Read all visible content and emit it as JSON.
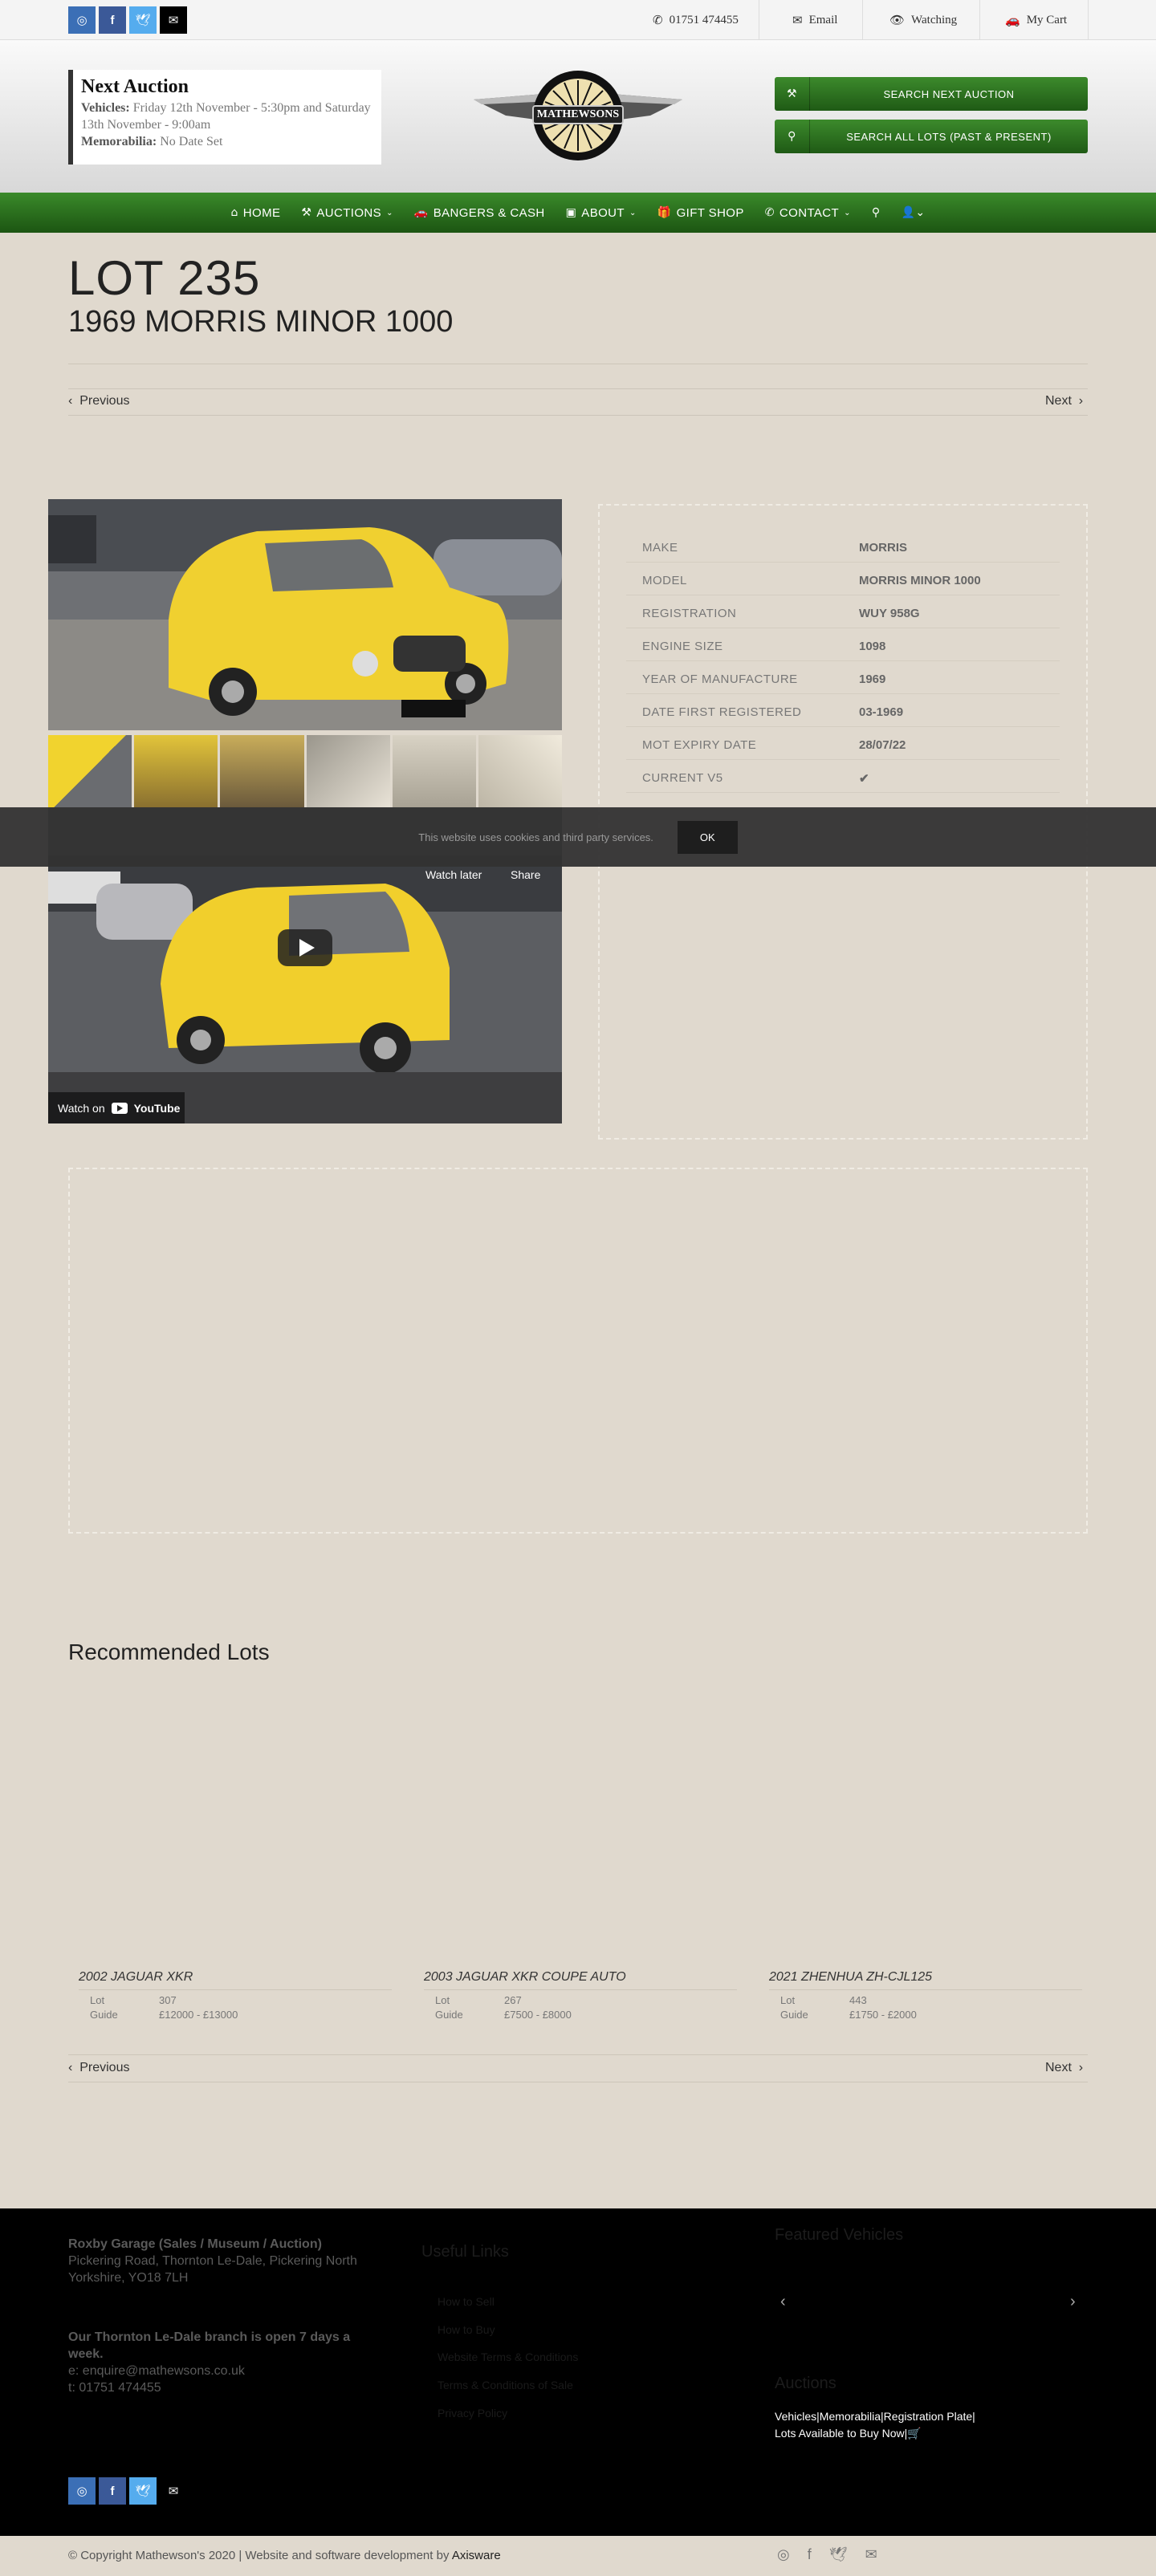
{
  "topbar": {
    "phone": "01751 474455",
    "email": "Email",
    "watching": "Watching",
    "cart": "My Cart"
  },
  "auction_box": {
    "title": "Next Auction",
    "vehicles_label": "Vehicles:",
    "vehicles_text": "Friday 12th November - 5:30pm and Saturday 13th November - 9:00am",
    "memorabilia_label": "Memorabilia:",
    "memorabilia_text": "No Date Set"
  },
  "logo": {
    "text": "MATHEWSONS"
  },
  "buttons": {
    "search_next": "SEARCH NEXT AUCTION",
    "search_all": "SEARCH ALL LOTS (PAST & PRESENT)"
  },
  "nav": {
    "home": "HOME",
    "auctions": "AUCTIONS",
    "bangers": "BANGERS & CASH",
    "about": "ABOUT",
    "gift": "GIFT SHOP",
    "contact": "CONTACT"
  },
  "lot": {
    "number": "LOT 235",
    "title": "1969 MORRIS MINOR 1000"
  },
  "pager": {
    "previous": "Previous",
    "next": "Next"
  },
  "video": {
    "watch_later": "Watch later",
    "share": "Share",
    "watch_on": "Watch on",
    "youtube": "YouTube"
  },
  "specs": [
    {
      "k": "MAKE",
      "v": "MORRIS"
    },
    {
      "k": "MODEL",
      "v": "MORRIS MINOR 1000"
    },
    {
      "k": "REGISTRATION",
      "v": "WUY 958G"
    },
    {
      "k": "ENGINE SIZE",
      "v": "1098"
    },
    {
      "k": "YEAR OF MANUFACTURE",
      "v": "1969"
    },
    {
      "k": "DATE FIRST REGISTERED",
      "v": "03-1969"
    },
    {
      "k": "MOT EXPIRY DATE",
      "v": "28/07/22"
    },
    {
      "k": "CURRENT V5",
      "v": "✔"
    }
  ],
  "cookie": {
    "text": "This website uses cookies and third party services.",
    "ok": "OK"
  },
  "recommended": {
    "heading": "Recommended Lots",
    "items": [
      {
        "title": "2002 JAGUAR XKR",
        "lot_label": "Lot",
        "lot": "307",
        "guide_label": "Guide",
        "guide": "£12000 - £13000"
      },
      {
        "title": "2003 JAGUAR XKR COUPE AUTO",
        "lot_label": "Lot",
        "lot": "267",
        "guide_label": "Guide",
        "guide": "£7500 - £8000"
      },
      {
        "title": "2021 ZHENHUA ZH-CJL125",
        "lot_label": "Lot",
        "lot": "443",
        "guide_label": "Guide",
        "guide": "£1750 - £2000"
      }
    ]
  },
  "footer": {
    "address_title": "Roxby Garage (Sales / Museum / Auction)",
    "address": "Pickering Road, Thornton Le-Dale, Pickering North Yorkshire, YO18 7LH",
    "open": "Our Thornton Le-Dale branch is open 7 days a week.",
    "email": "e: enquire@mathewsons.co.uk",
    "phone": "t: 01751 474455",
    "useful_links": "Useful Links",
    "links": [
      "How to Sell",
      "How to Buy",
      "Website Terms & Conditions",
      "Terms & Conditions of Sale",
      "Privacy Policy"
    ],
    "featured": "Featured Vehicles",
    "auctions": "Auctions",
    "auction_links_1": "Vehicles|Memorabilia|Registration Plate|",
    "auction_links_2": "Lots Available to Buy Now|",
    "copyright": "© Copyright Mathewson's 2020 | Website and software development by",
    "axisware": "Axisware"
  }
}
